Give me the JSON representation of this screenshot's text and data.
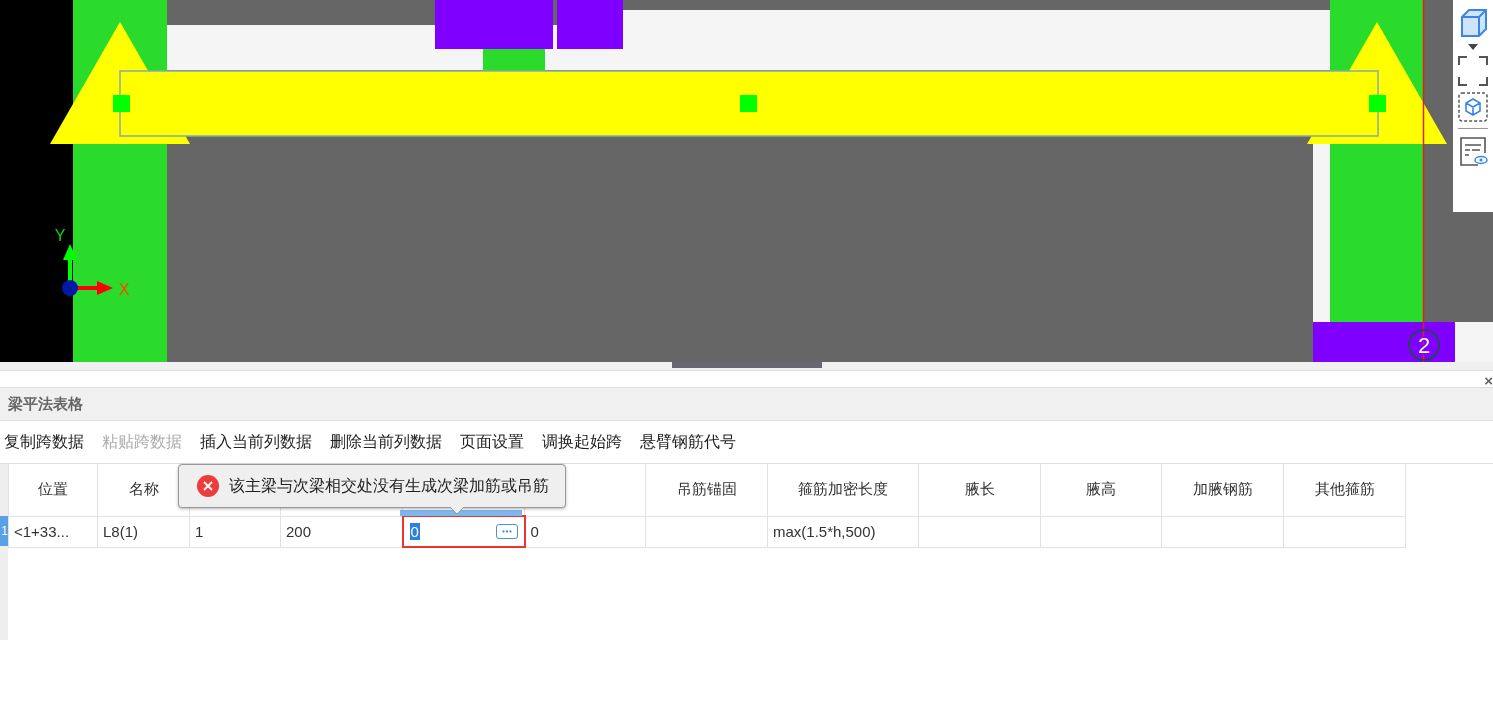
{
  "canvas": {
    "axis_labels": {
      "x": "X",
      "y": "Y"
    },
    "grid_marker": "2"
  },
  "panel": {
    "title": "梁平法表格",
    "close_symbol": "×"
  },
  "toolbar": [
    {
      "label": "复制跨数据",
      "disabled": false
    },
    {
      "label": "粘贴跨数据",
      "disabled": true
    },
    {
      "label": "插入当前列数据",
      "disabled": false
    },
    {
      "label": "删除当前列数据",
      "disabled": false
    },
    {
      "label": "页面设置",
      "disabled": false
    },
    {
      "label": "调换起始跨",
      "disabled": false
    },
    {
      "label": "悬臂钢筋代号",
      "disabled": false
    }
  ],
  "table": {
    "columns": [
      {
        "label": "位置"
      },
      {
        "label": "名称"
      },
      {},
      {},
      {},
      {},
      {
        "label": "吊筋锚固"
      },
      {
        "label": "箍筋加密长度"
      },
      {
        "label": "腋长"
      },
      {
        "label": "腋高"
      },
      {
        "label": "加腋钢筋"
      },
      {
        "label": "其他箍筋"
      }
    ],
    "rows": [
      {
        "row_number": "1",
        "selected": true,
        "cells": [
          {
            "text": "<1+33..."
          },
          {
            "text": "L8(1)"
          },
          {
            "text": "1"
          },
          {
            "text": "200"
          },
          {
            "text": "0",
            "editing": true
          },
          {
            "text": "0"
          },
          {},
          {
            "text": "max(1.5*h,500)"
          },
          {},
          {},
          {},
          {}
        ]
      }
    ]
  },
  "tooltip": {
    "kind": "error",
    "message": "该主梁与次梁相交处没有生成次梁加筋或吊筋"
  }
}
